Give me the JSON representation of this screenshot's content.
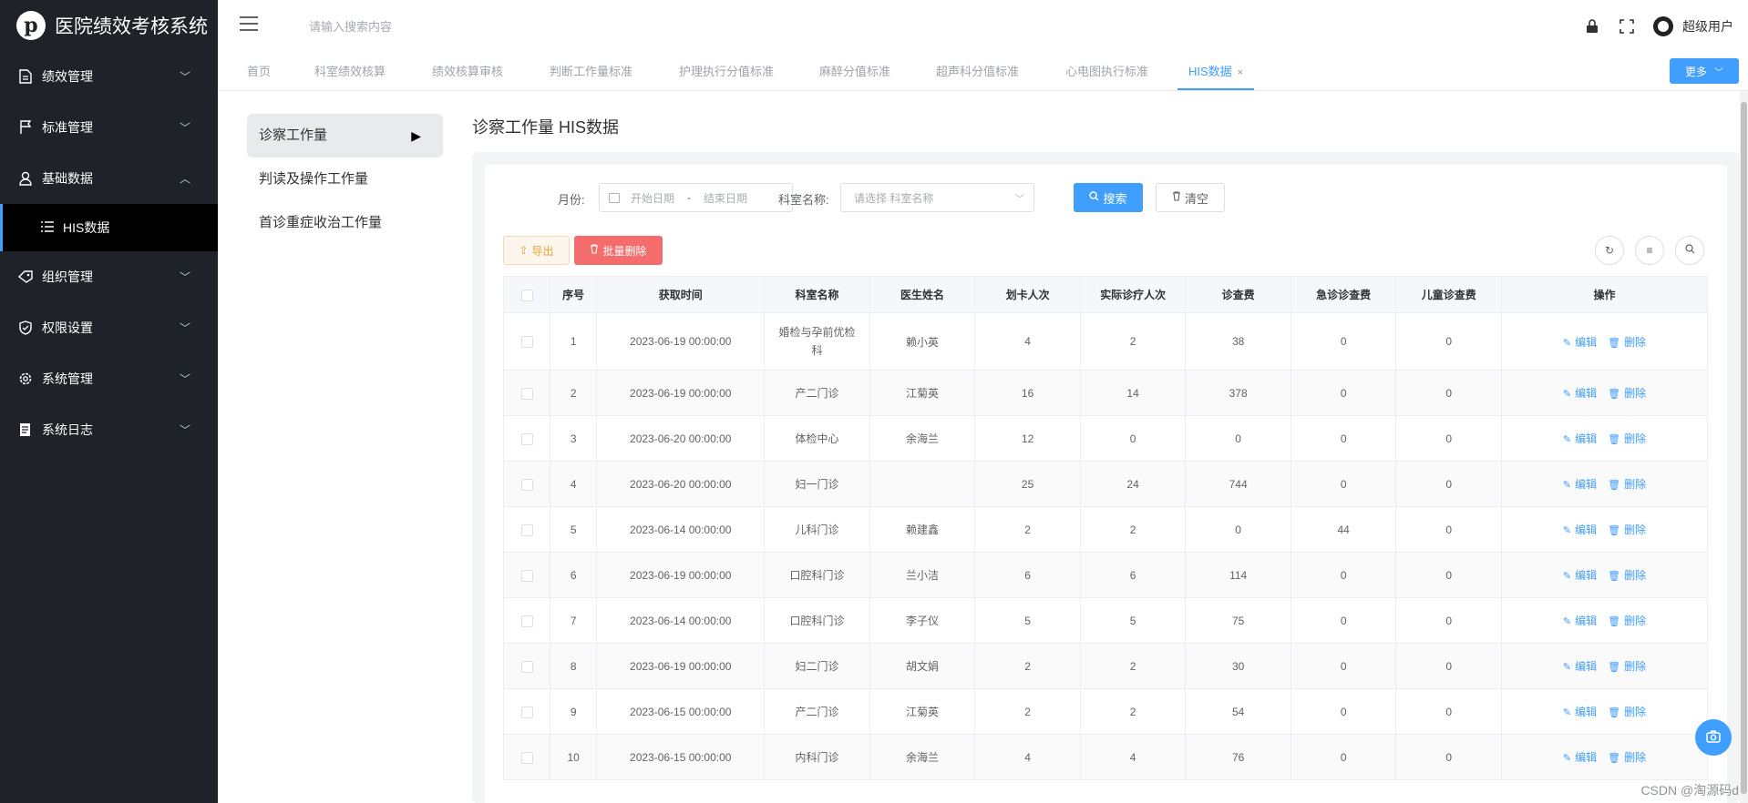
{
  "app": {
    "title": "医院绩效考核系统",
    "logo_letter": "p"
  },
  "sidebar": {
    "items": [
      {
        "label": "绩效管理",
        "icon": "document-icon"
      },
      {
        "label": "标准管理",
        "icon": "flag-icon"
      },
      {
        "label": "基础数据",
        "icon": "user-icon",
        "expanded": true
      },
      {
        "label": "HIS数据",
        "icon": "list-icon",
        "active": true
      },
      {
        "label": "组织管理",
        "icon": "tag-icon"
      },
      {
        "label": "权限设置",
        "icon": "shield-icon"
      },
      {
        "label": "系统管理",
        "icon": "gear-icon"
      },
      {
        "label": "系统日志",
        "icon": "log-icon"
      }
    ]
  },
  "header": {
    "search_placeholder": "请输入搜索内容",
    "user_name": "超级用户"
  },
  "tabs": [
    {
      "label": "首页"
    },
    {
      "label": "科室绩效核算"
    },
    {
      "label": "绩效核算审核"
    },
    {
      "label": "判断工作量标准"
    },
    {
      "label": "护理执行分值标准"
    },
    {
      "label": "麻醉分值标准"
    },
    {
      "label": "超声科分值标准"
    },
    {
      "label": "心电图执行标准"
    },
    {
      "label": "HIS数据",
      "active": true
    }
  ],
  "tabs_close": "×",
  "more_label": "更多",
  "subnav": [
    {
      "label": "诊察工作量",
      "active": true
    },
    {
      "label": "判读及操作工作量"
    },
    {
      "label": "首诊重症收治工作量"
    }
  ],
  "content": {
    "title": "诊察工作量 HIS数据",
    "filters": {
      "month_label": "月份:",
      "start_placeholder": "开始日期",
      "date_separator": "-",
      "end_placeholder": "结束日期",
      "dept_label": "科室名称:",
      "dept_placeholder": "请选择 科室名称",
      "search_label": "搜索",
      "clear_label": "清空"
    },
    "toolbar": {
      "export_label": "导出",
      "batch_delete_label": "批量删除"
    },
    "table": {
      "headers": [
        "序号",
        "获取时间",
        "科室名称",
        "医生姓名",
        "划卡人次",
        "实际诊疗人次",
        "诊查费",
        "急诊诊查费",
        "儿童诊查费",
        "操作"
      ],
      "edit_label": "编辑",
      "delete_label": "删除",
      "rows": [
        [
          "1",
          "2023-06-19 00:00:00",
          "婚检与孕前优检科",
          "赖小英",
          "4",
          "2",
          "38",
          "0",
          "0"
        ],
        [
          "2",
          "2023-06-19 00:00:00",
          "产二门诊",
          "江菊英",
          "16",
          "14",
          "378",
          "0",
          "0"
        ],
        [
          "3",
          "2023-06-20 00:00:00",
          "体检中心",
          "余海兰",
          "12",
          "0",
          "0",
          "0",
          "0"
        ],
        [
          "4",
          "2023-06-20 00:00:00",
          "妇一门诊",
          "",
          "25",
          "24",
          "744",
          "0",
          "0"
        ],
        [
          "5",
          "2023-06-14 00:00:00",
          "儿科门诊",
          "赖建鑫",
          "2",
          "2",
          "0",
          "44",
          "0"
        ],
        [
          "6",
          "2023-06-19 00:00:00",
          "口腔科门诊",
          "兰小洁",
          "6",
          "6",
          "114",
          "0",
          "0"
        ],
        [
          "7",
          "2023-06-14 00:00:00",
          "口腔科门诊",
          "李子仪",
          "5",
          "5",
          "75",
          "0",
          "0"
        ],
        [
          "8",
          "2023-06-19 00:00:00",
          "妇二门诊",
          "胡文娟",
          "2",
          "2",
          "30",
          "0",
          "0"
        ],
        [
          "9",
          "2023-06-15 00:00:00",
          "产二门诊",
          "江菊英",
          "2",
          "2",
          "54",
          "0",
          "0"
        ],
        [
          "10",
          "2023-06-15 00:00:00",
          "内科门诊",
          "余海兰",
          "4",
          "4",
          "76",
          "0",
          "0"
        ]
      ]
    }
  },
  "watermark": "CSDN @淘源码d",
  "colors": {
    "primary": "#409eff",
    "danger": "#f56c6c",
    "warning": "#e6a23c",
    "sidebar_bg": "#1f2229"
  }
}
